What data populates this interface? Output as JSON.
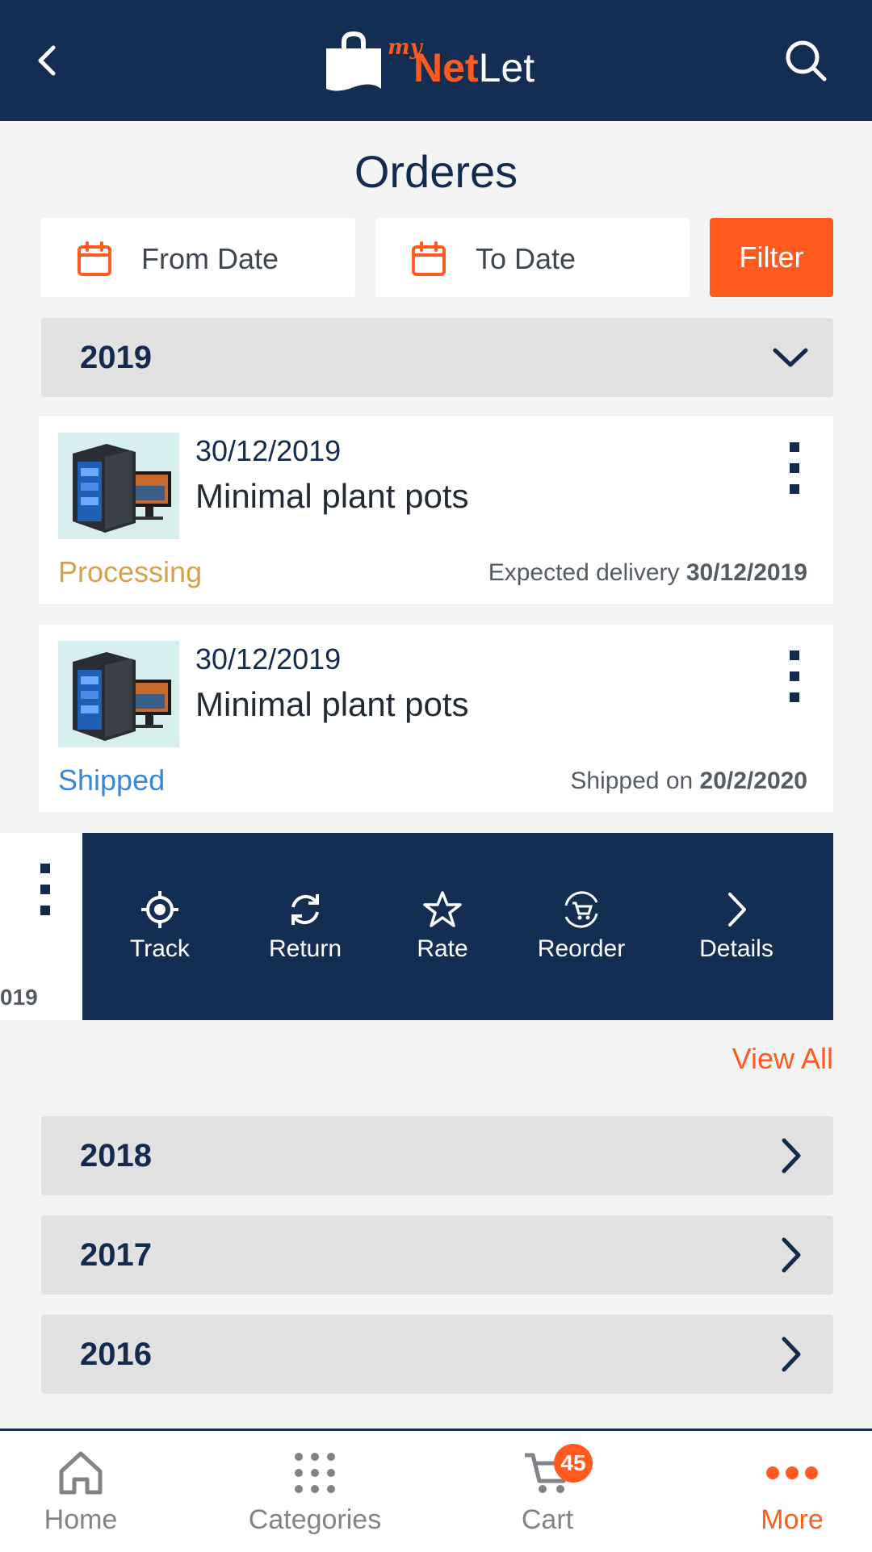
{
  "header": {
    "logo_small": "my",
    "logo_net": "Net",
    "logo_let": "Let",
    "back_icon": "chevron-left-icon",
    "search_icon": "search-icon"
  },
  "page": {
    "title": "Orderes"
  },
  "filters": {
    "from_label": "From Date",
    "to_label": "To Date",
    "filter_label": "Filter",
    "calendar_icon": "calendar-icon"
  },
  "years": {
    "expanded": "2019",
    "collapsed": [
      "2018",
      "2017",
      "2016"
    ]
  },
  "orders": [
    {
      "date": "30/12/2019",
      "name": "Minimal plant pots",
      "status": "Processing",
      "status_color": "#d4a24c",
      "meta_label": "Expected delivery ",
      "meta_value": "30/12/2019"
    },
    {
      "date": "30/12/2019",
      "name": "Minimal plant pots",
      "status": "Shipped",
      "status_color": "#3a86d6",
      "meta_label": "Shipped on ",
      "meta_value": "20/2/2020"
    }
  ],
  "swiped_card": {
    "date_fragment": "019"
  },
  "actions": [
    {
      "label": "Track",
      "icon": "target-icon"
    },
    {
      "label": "Return",
      "icon": "refresh-icon"
    },
    {
      "label": "Rate",
      "icon": "star-icon"
    },
    {
      "label": "Reorder",
      "icon": "cart-refresh-icon"
    },
    {
      "label": "Details",
      "icon": "chevron-right-icon"
    }
  ],
  "view_all": "View All",
  "bottom_nav": {
    "home": "Home",
    "categories": "Categories",
    "cart": "Cart",
    "cart_count": "45",
    "more": "More",
    "active_color": "#ff5a1f"
  },
  "colors": {
    "primary": "#142d52",
    "accent": "#ff5a1f"
  }
}
